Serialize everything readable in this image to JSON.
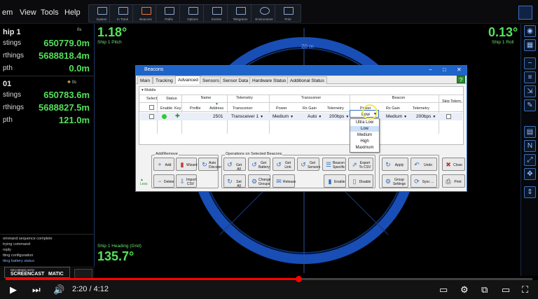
{
  "menu": {
    "items": [
      "em",
      "View",
      "Tools",
      "Help"
    ]
  },
  "toolbar": {
    "buttons": [
      "System",
      "In Track",
      "Beacons",
      "Paths",
      "Options",
      "Events",
      "Telegrams",
      "Environment",
      "Print"
    ]
  },
  "left_panel": {
    "ship1_header": "hip 1",
    "rows1": [
      {
        "label": "stings",
        "value": "650779.0m"
      },
      {
        "label": "rthings",
        "value": "5688818.4m"
      },
      {
        "label": "pth",
        "value": "0.0m"
      }
    ],
    "ship2_header": "01",
    "rows2": [
      {
        "label": "stings",
        "value": "650783.6m"
      },
      {
        "label": "rthings",
        "value": "5688827.5m"
      },
      {
        "label": "pth",
        "value": "121.0m"
      }
    ],
    "badge1": "0s",
    "badge2": "0s",
    "log": [
      "ommand sequence complete",
      "trying command",
      "reply",
      "tting configuration",
      "tting battery status"
    ]
  },
  "readouts": {
    "pitch_value": "1.18°",
    "pitch_label": "Ship 1 Pitch",
    "roll_value": "0.13°",
    "roll_label": "Ship 1 Roll",
    "heading_label": "Ship 1 Heading (Grid)",
    "heading_value": "135.7°",
    "range_label": "20 m"
  },
  "dialog": {
    "title": "Beacons",
    "tabs": [
      "Main",
      "Tracking",
      "Advanced",
      "Sensors",
      "Sensor Data",
      "Hardware Status",
      "Additional Status"
    ],
    "active_tab": "Advanced",
    "section_label": "Mobile",
    "groups": {
      "name": "Name",
      "telemetry": "Telemetry",
      "transceiver": "Transceiver",
      "beacon": "Beacon"
    },
    "columns": {
      "select": "Select",
      "status": "Status",
      "enable": "Enable",
      "key": "Key",
      "profile": "Profile",
      "address": "Address",
      "transceiver": "Transceiver",
      "power": "Power",
      "rx_gain": "Rx Gain",
      "telemetry": "Telemetry",
      "beacon_power": "Power",
      "beacon_rx_gain": "Rx Gain",
      "beacon_telemetry": "Telemetry",
      "skip_telemetry": "Skip Telem."
    },
    "row": {
      "address": "2501",
      "transceiver": "Transceiver 1",
      "power": "Medium",
      "rx_gain": "Auto",
      "telemetry": "200bps",
      "beacon_power": "Low",
      "beacon_rx_gain": "Medium",
      "beacon_telemetry": "200bps"
    },
    "dropdown_options": [
      "Ultra Low",
      "Low",
      "Medium",
      "High",
      "Maximum"
    ],
    "dropdown_selected": "Low",
    "add_remove_label": "Add/Remove",
    "ops_label": "Operations on Selected Beacons",
    "buttons": {
      "add": "Add",
      "wizard": "Wizard",
      "auto_discover": "Auto Discover",
      "delete": "Delete",
      "import_csv": "Import CSV",
      "get_all": "Get All",
      "get_battery": "Get Battery",
      "get_link": "Get Link",
      "get_sensors": "Get Sensors",
      "beacon_specific": "Beacon Specific",
      "export_csv": "Export To CSV",
      "set_all": "Set All",
      "change_groups": "Change Groups",
      "release": "Release",
      "enable": "Enable",
      "disable": "Disable",
      "apply": "Apply",
      "undo": "Undo",
      "close": "Close",
      "group_settings": "Group Settings",
      "sync": "Sync ...",
      "print": "Print"
    },
    "less_label": "Less"
  },
  "player": {
    "time": "2:20 / 4:12",
    "progress": 0.556,
    "recorded_with": "RECORDED WITH",
    "brand": "SCREENCAST",
    "brand2": "MATIC"
  }
}
